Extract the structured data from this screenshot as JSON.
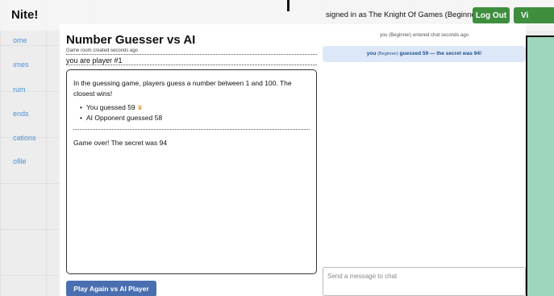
{
  "header": {
    "brand": "Nite!",
    "signed_in_text": "signed in as The Knight Of Games (Beginner)",
    "logout_label": "Log Out",
    "extra_button_label": "Vi"
  },
  "sidebar": {
    "items": [
      {
        "label": "ome"
      },
      {
        "label": "ımes"
      },
      {
        "label": "rum"
      },
      {
        "label": "ends"
      },
      {
        "label": "cations"
      },
      {
        "label": "ofile"
      }
    ]
  },
  "game": {
    "title": "Number Guesser vs AI",
    "created": "Game room created seconds ago",
    "player_number": "you are player #1",
    "rules": "In the guessing game, players guess a number between 1 and 100. The closest wins!",
    "guesses": [
      {
        "text": "You guessed 59",
        "winner_icon": "crown-icon"
      },
      {
        "text": "AI Opponent guessed 58"
      }
    ],
    "result": "Game over! The secret was 94",
    "play_again_label": "Play Again vs AI Player"
  },
  "chat": {
    "entered_notice": "you (Beginner) entered chat seconds ago",
    "message_user": "you",
    "message_level": "(Beginner)",
    "message_text": "guessed 59 — the secret was 94!",
    "input_placeholder": "Send a message to chat"
  },
  "colors": {
    "accent_green": "#3e8e3e",
    "button_blue": "#4a6fb0",
    "chat_bubble": "#dce8f7",
    "side_panel": "#9ed6bd",
    "link_blue": "#4a90d9"
  }
}
